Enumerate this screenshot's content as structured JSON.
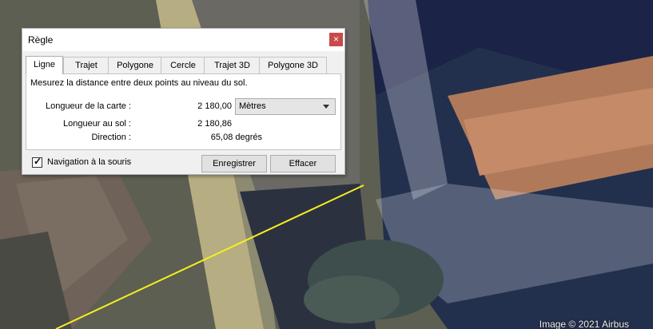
{
  "dialog": {
    "title": "Règle",
    "close_glyph": "×",
    "tabs": [
      {
        "label": "Ligne",
        "active": true
      },
      {
        "label": "Trajet",
        "active": false
      },
      {
        "label": "Polygone",
        "active": false
      },
      {
        "label": "Cercle",
        "active": false
      },
      {
        "label": "Trajet 3D",
        "active": false
      },
      {
        "label": "Polygone 3D",
        "active": false
      }
    ],
    "description": "Mesurez la distance entre deux points au niveau du sol.",
    "map_length_label": "Longueur de la carte :",
    "map_length_value": "2 180,00",
    "unit_selected": "Mètres",
    "ground_length_label": "Longueur au sol :",
    "ground_length_value": "2 180,86",
    "direction_label": "Direction :",
    "direction_value": "65,08 degrés",
    "mouse_nav_label": "Navigation à la souris",
    "mouse_nav_checked": true,
    "check_glyph": "✓",
    "save_label": "Enregistrer",
    "clear_label": "Effacer"
  },
  "map": {
    "attribution": "Image © 2021 Airbus",
    "measure_line_color": "#f5ee20"
  }
}
